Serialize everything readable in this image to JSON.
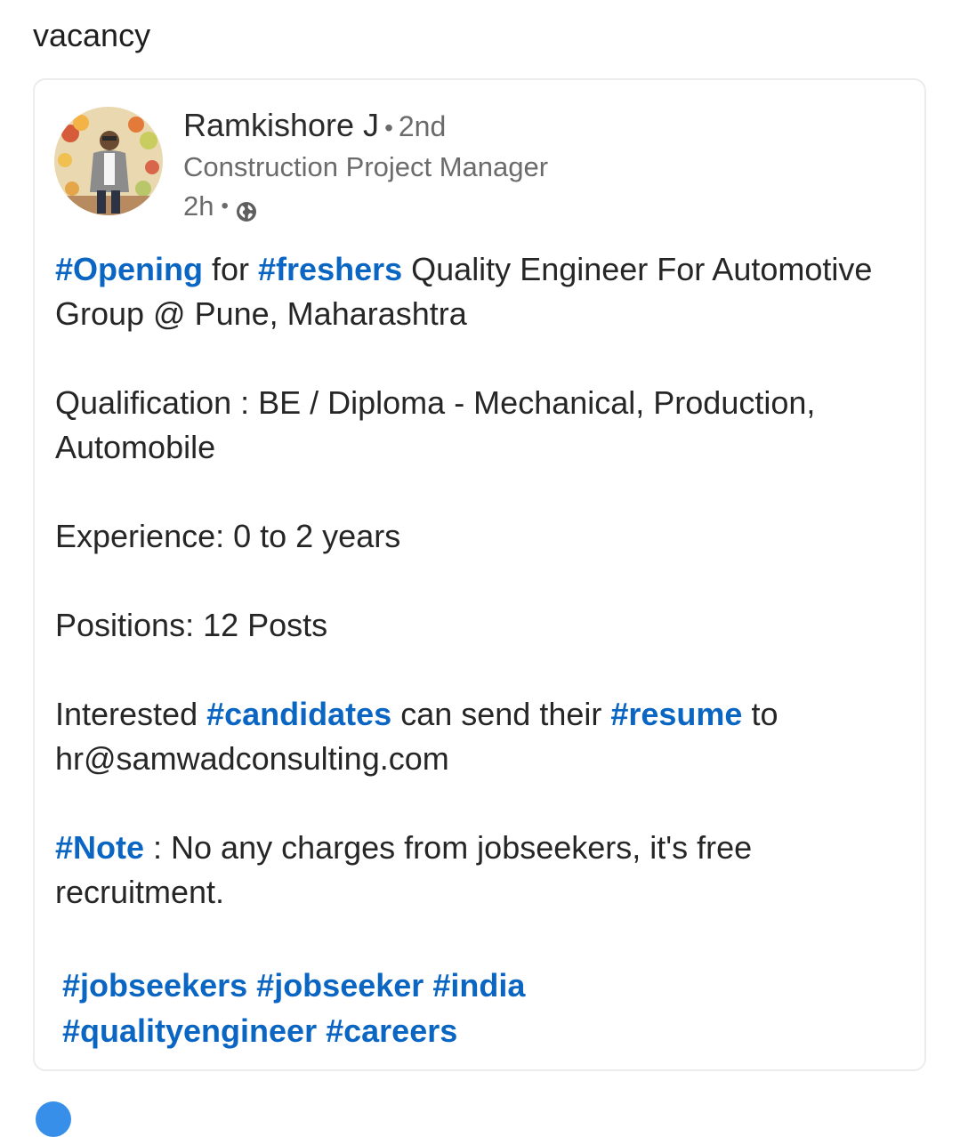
{
  "caption": "vacancy",
  "post": {
    "author": {
      "name": "Ramkishore J",
      "connection": "2nd",
      "headline": "Construction Project Manager",
      "time": "2h",
      "visibility_icon": "globe-icon"
    },
    "p1": {
      "tag1": "#Opening",
      "t1": " for ",
      "tag2": "#freshers",
      "t2": " Quality Engineer For Automotive Group @ Pune, Maharashtra"
    },
    "p2": "Qualification : BE / Diploma - Mechanical, Production, Automobile",
    "p3": "Experience: 0 to 2 years",
    "p4": "Positions: 12 Posts",
    "p5": {
      "t1": "Interested ",
      "tag1": "#candidates",
      "t2": " can send their ",
      "tag2": "#resume",
      "t3": " to hr@samwadconsulting.com"
    },
    "p6": {
      "tag1": "#Note",
      "t1": " : No any charges from jobseekers, it's free recruitment."
    },
    "hashtags": [
      "#jobseekers",
      "#jobseeker",
      "#india",
      "#qualityengineer",
      "#careers"
    ]
  },
  "colors": {
    "link": "#0a66c2",
    "text": "#262626",
    "muted": "#6b6b6b"
  }
}
